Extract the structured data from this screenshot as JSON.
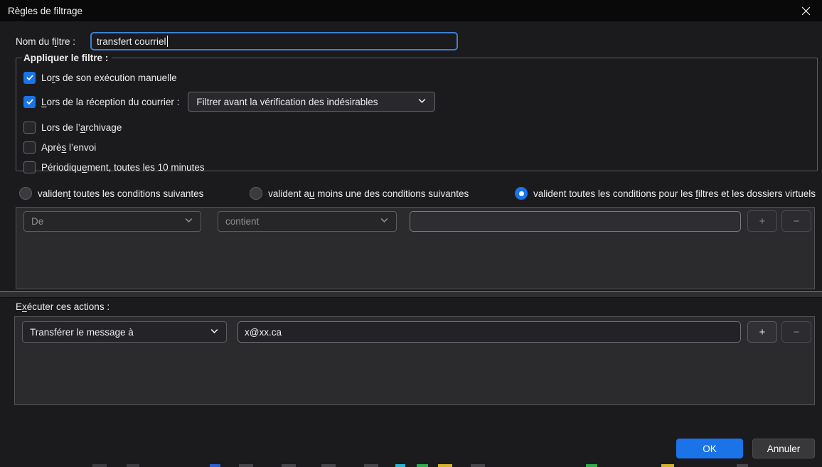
{
  "window": {
    "title": "Règles de filtrage",
    "close_icon": "✕"
  },
  "colors": {
    "accent_blue": "#1a73e8",
    "focus_border": "#3e7fd3",
    "panel_bg": "#2b2b2e",
    "dialog_bg": "#1b1b1d",
    "titlebar_bg": "#090909"
  },
  "filter_name": {
    "label": {
      "pre": "Nom du f",
      "key": "i",
      "post": "ltre :"
    },
    "value": "transfert courriel"
  },
  "apply_group": {
    "legend": "Appliquer le filtre :",
    "checkboxes": [
      {
        "checked": true,
        "label": {
          "pre": "Lo",
          "key": "r",
          "post": "s de son exécution manuelle"
        }
      },
      {
        "checked": true,
        "label": {
          "pre": "",
          "key": "L",
          "post": "ors de la réception du courrier :"
        },
        "dropdown_value": "Filtrer avant la vérification des indésirables"
      },
      {
        "checked": false,
        "label": {
          "pre": "Lors de l’",
          "key": "a",
          "post": "rchivage"
        }
      },
      {
        "checked": false,
        "label": {
          "pre": "Aprè",
          "key": "s",
          "post": " l’envoi"
        }
      },
      {
        "checked": false,
        "label": {
          "pre": "Périodiqu",
          "key": "e",
          "post": "ment, toutes les 10 minutes"
        }
      }
    ]
  },
  "match_options": [
    {
      "selected": false,
      "label": {
        "pre": "validen",
        "key": "t",
        "post": " toutes les conditions suivantes"
      }
    },
    {
      "selected": false,
      "label": {
        "pre": "valident a",
        "key": "u",
        "post": " moins une des conditions suivantes"
      }
    },
    {
      "selected": true,
      "label": {
        "pre": "valident toutes les conditions pour les ",
        "key": "f",
        "post": "iltres et les dossiers virtuels"
      }
    }
  ],
  "conditions": {
    "attribute_value": "De",
    "operator_value": "contient",
    "value": "",
    "add_label": "+",
    "remove_label": "−"
  },
  "actions_section": {
    "label": {
      "pre": "E",
      "key": "x",
      "post": "écuter ces actions :"
    },
    "action_value": "Transférer le message à",
    "value": "x@xx.ca",
    "add_label": "+",
    "remove_label": "−"
  },
  "buttons": {
    "ok": "OK",
    "cancel": "Annuler"
  }
}
